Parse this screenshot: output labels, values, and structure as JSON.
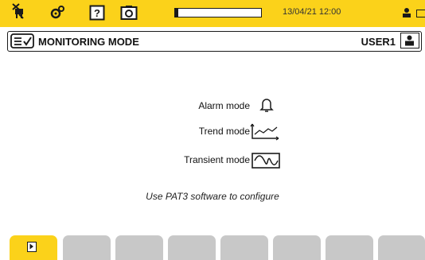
{
  "status_bar": {
    "datetime": "13/04/21 12:00",
    "progress": 0.04,
    "icons": [
      "plug-icon",
      "settings-icon",
      "help-icon",
      "camera-icon",
      "network-icon",
      "battery-icon"
    ]
  },
  "title_bar": {
    "icon": "monitoring-checklist-icon",
    "title": "MONITORING MODE",
    "user": "USER1",
    "user_icon": "user-icon"
  },
  "modes": [
    {
      "label": "Alarm mode",
      "icon": "bell-icon"
    },
    {
      "label": "Trend mode",
      "icon": "trend-chart-icon"
    },
    {
      "label": "Transient mode",
      "icon": "transient-wave-icon"
    }
  ],
  "hint": "Use PAT3 software to configure",
  "softkeys": {
    "count": 8,
    "active_index": 0,
    "active_icon": "play-icon"
  },
  "colors": {
    "accent": "#fbd21a",
    "softkey": "#c8c8c8",
    "ink": "#1a1a1a"
  }
}
